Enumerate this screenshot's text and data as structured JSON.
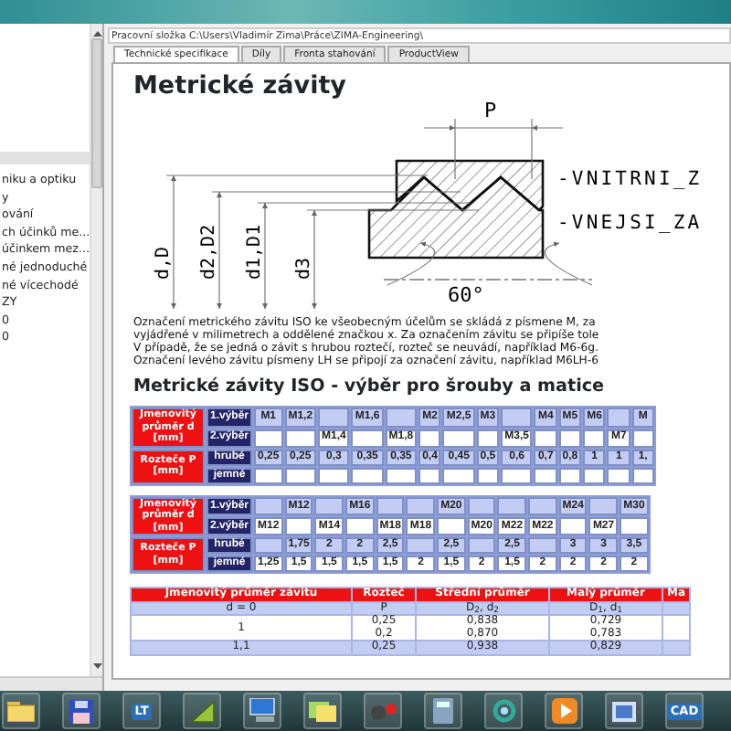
{
  "sidebar": {
    "items": [
      "niku a optiku",
      "y",
      "ování",
      "ch účinků me...",
      "účinkem mez...",
      "né jednoduché",
      "né vícechodé",
      "ZY",
      "0",
      "0"
    ]
  },
  "path_bar": {
    "label": "Pracovní složka",
    "path": "C:\\Users\\Vladimír Zima\\Práce\\ZIMA-Engineering\\"
  },
  "tabs": [
    {
      "label": "Technické specifikace",
      "selected": true
    },
    {
      "label": "Díly",
      "selected": false
    },
    {
      "label": "Fronta stahování",
      "selected": false
    },
    {
      "label": "ProductView",
      "selected": false
    }
  ],
  "content": {
    "title": "Metrické závity",
    "drawing": {
      "pitch": "P",
      "angle": "60°",
      "diameters": [
        "d,D",
        "d2,D2",
        "d1,D1",
        "d3"
      ],
      "callouts": [
        "-VNITRNI_Z",
        "-VNEJSI_ZA"
      ]
    },
    "paragraph_lines": [
      "Označení metrického závitu ISO ke všeobecným účelům se skládá z písmene M, za",
      "vyjádřené v milimetrech a oddělené značkou x. Za označením závitu se připíše tole",
      "V případě, že se jedná o závit s hrubou roztečí, rozteč se neuvádí, například M6-6g.",
      "Označení levého závitu písmeny LH se připojí za označení závitu, například M6LH-6"
    ],
    "heading": "Metrické závity ISO - výběr pro šrouby a matice",
    "table_1": {
      "groups": [
        {
          "label": "Jmenovitý průměr d [mm]",
          "rows": [
            "1.výběr",
            "2.výběr"
          ]
        },
        {
          "label": "Rozteče P [mm]",
          "rows": [
            "hrubé",
            "jemné"
          ]
        }
      ],
      "columns": [
        {
          "first_choice": "M1",
          "coarse": "0,25"
        },
        {
          "first_choice": "M1,2",
          "coarse": "0,25"
        },
        {
          "second_choice": "M1,4",
          "coarse": "0,3"
        },
        {
          "first_choice": "M1,6",
          "coarse": "0,35"
        },
        {
          "second_choice": "M1,8",
          "coarse": "0,35"
        },
        {
          "first_choice": "M2",
          "coarse": "0,4"
        },
        {
          "first_choice": "M2,5",
          "coarse": "0,45"
        },
        {
          "first_choice": "M3",
          "coarse": "0,5"
        },
        {
          "second_choice": "M3,5",
          "coarse": "0,6"
        },
        {
          "first_choice": "M4",
          "coarse": "0,7"
        },
        {
          "first_choice": "M5",
          "coarse": "0,8"
        },
        {
          "first_choice": "M6",
          "coarse": "1"
        },
        {
          "second_choice": "M7",
          "coarse": "1"
        },
        {
          "first_choice": "M",
          "coarse": "1,"
        }
      ]
    },
    "table_2": {
      "groups": [
        {
          "label": "Jmenovitý průměr d [mm]",
          "rows": [
            "1.výběr",
            "2.výběr"
          ]
        },
        {
          "label": "Rozteče P [mm]",
          "rows": [
            "hrubé",
            "jemné"
          ]
        }
      ],
      "columns": [
        {
          "second_choice": "M12",
          "fine": "1,25"
        },
        {
          "first_choice": "M12",
          "coarse": "1,75",
          "fine": "1,5"
        },
        {
          "second_choice": "M14",
          "coarse": "2",
          "fine": "1,5"
        },
        {
          "first_choice": "M16",
          "coarse": "2",
          "fine": "1,5"
        },
        {
          "second_choice": "M18",
          "coarse": "2,5",
          "fine": "1,5"
        },
        {
          "second_choice": "M18",
          "fine": "2"
        },
        {
          "first_choice": "M20",
          "coarse": "2,5",
          "fine": "1,5"
        },
        {
          "second_choice": "M20",
          "fine": "2"
        },
        {
          "second_choice": "M22",
          "coarse": "2,5",
          "fine": "1,5"
        },
        {
          "second_choice": "M22",
          "fine": "2"
        },
        {
          "first_choice": "M24",
          "coarse": "3",
          "fine": "2"
        },
        {
          "second_choice": "M27",
          "coarse": "3",
          "fine": "2"
        },
        {
          "first_choice": "M30",
          "coarse": "3,5",
          "fine": "2"
        }
      ]
    },
    "table_3": {
      "columns": [
        "Jmenovitý průměr závitu",
        "Rozteč",
        "Střední průměr",
        "Malý průměr",
        "Ma"
      ],
      "rows": [
        {
          "diameter": [
            "d = 0"
          ],
          "pitch": [
            "P"
          ],
          "pitch_diameter": [
            "D$_{2}$, d$_{2}$"
          ],
          "minor_diameter": [
            "D$_{1}$, d$_{1}$"
          ]
        },
        {
          "diameter": [
            "1"
          ],
          "pitch": [
            "0,25",
            "0,2"
          ],
          "pitch_diameter": [
            "0,838",
            "0,870"
          ],
          "minor_diameter": [
            "0,729",
            "0,783"
          ]
        },
        {
          "diameter": [
            "1,1"
          ],
          "pitch": [
            "0,25"
          ],
          "pitch_diameter": [
            "0,938"
          ],
          "minor_diameter": [
            "0,829"
          ]
        }
      ]
    }
  },
  "taskbar": {
    "items": [
      {
        "kind": "folder"
      },
      {
        "kind": "floppy"
      },
      {
        "kind": "text",
        "label": "LT"
      },
      {
        "kind": "chart"
      },
      {
        "kind": "computer"
      },
      {
        "kind": "notes"
      },
      {
        "kind": "xm"
      },
      {
        "kind": "calculator"
      },
      {
        "kind": "sync"
      },
      {
        "kind": "play"
      },
      {
        "kind": "window"
      },
      {
        "kind": "text",
        "label": "CAD"
      }
    ]
  }
}
